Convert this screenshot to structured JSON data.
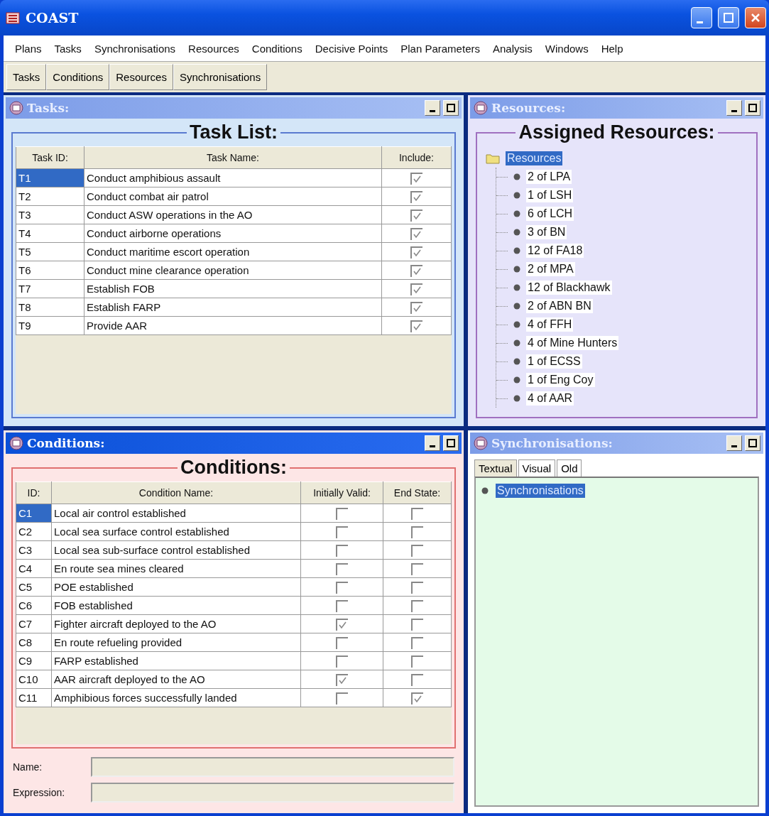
{
  "window": {
    "title": "COAST"
  },
  "menu": [
    "Plans",
    "Tasks",
    "Synchronisations",
    "Resources",
    "Conditions",
    "Decisive Points",
    "Plan Parameters",
    "Analysis",
    "Windows",
    "Help"
  ],
  "toolbar": [
    "Tasks",
    "Conditions",
    "Resources",
    "Synchronisations"
  ],
  "tasks": {
    "title": "Tasks:",
    "active": false,
    "legend": "Task List:",
    "columns": [
      "Task ID:",
      "Task Name:",
      "Include:"
    ],
    "rows": [
      {
        "id": "T1",
        "name": "Conduct amphibious assault",
        "include": true,
        "selected": true
      },
      {
        "id": "T2",
        "name": "Conduct combat air patrol",
        "include": true,
        "selected": false
      },
      {
        "id": "T3",
        "name": "Conduct ASW operations in the AO",
        "include": true,
        "selected": false
      },
      {
        "id": "T4",
        "name": "Conduct airborne operations",
        "include": true,
        "selected": false
      },
      {
        "id": "T5",
        "name": "Conduct maritime escort operation",
        "include": true,
        "selected": false
      },
      {
        "id": "T6",
        "name": "Conduct mine clearance operation",
        "include": true,
        "selected": false
      },
      {
        "id": "T7",
        "name": "Establish FOB",
        "include": true,
        "selected": false
      },
      {
        "id": "T8",
        "name": "Establish FARP",
        "include": true,
        "selected": false
      },
      {
        "id": "T9",
        "name": "Provide AAR",
        "include": true,
        "selected": false
      }
    ]
  },
  "resources": {
    "title": "Resources:",
    "active": false,
    "legend": "Assigned Resources:",
    "tree": {
      "label": "Resources",
      "selected": true,
      "children": [
        {
          "label": "2 of LPA",
          "selected": false
        },
        {
          "label": "1 of LSH",
          "selected": false
        },
        {
          "label": "6 of LCH",
          "selected": false
        },
        {
          "label": "3 of BN",
          "selected": false
        },
        {
          "label": "12 of FA18",
          "selected": false
        },
        {
          "label": "2 of MPA",
          "selected": false
        },
        {
          "label": "12 of Blackhawk",
          "selected": false
        },
        {
          "label": "2 of ABN BN",
          "selected": false
        },
        {
          "label": "4 of FFH",
          "selected": false
        },
        {
          "label": "4 of Mine Hunters",
          "selected": false
        },
        {
          "label": "1 of ECSS",
          "selected": false
        },
        {
          "label": "1 of Eng Coy",
          "selected": false
        },
        {
          "label": "4 of AAR",
          "selected": false
        }
      ]
    }
  },
  "conditions": {
    "title": "Conditions:",
    "active": true,
    "legend": "Conditions:",
    "columns": [
      "ID:",
      "Condition Name:",
      "Initially Valid:",
      "End State:"
    ],
    "rows": [
      {
        "id": "C1",
        "name": "Local air control established",
        "initially_valid": false,
        "end_state": false,
        "selected": true
      },
      {
        "id": "C2",
        "name": "Local sea surface control established",
        "initially_valid": false,
        "end_state": false,
        "selected": false
      },
      {
        "id": "C3",
        "name": "Local sea sub-surface control established",
        "initially_valid": false,
        "end_state": false,
        "selected": false
      },
      {
        "id": "C4",
        "name": "En route sea mines cleared",
        "initially_valid": false,
        "end_state": false,
        "selected": false
      },
      {
        "id": "C5",
        "name": "POE established",
        "initially_valid": false,
        "end_state": false,
        "selected": false
      },
      {
        "id": "C6",
        "name": "FOB established",
        "initially_valid": false,
        "end_state": false,
        "selected": false
      },
      {
        "id": "C7",
        "name": "Fighter aircraft deployed to the AO",
        "initially_valid": true,
        "end_state": false,
        "selected": false
      },
      {
        "id": "C8",
        "name": "En route refueling provided",
        "initially_valid": false,
        "end_state": false,
        "selected": false
      },
      {
        "id": "C9",
        "name": "FARP established",
        "initially_valid": false,
        "end_state": false,
        "selected": false
      },
      {
        "id": "C10",
        "name": "AAR aircraft deployed to the AO",
        "initially_valid": true,
        "end_state": false,
        "selected": false
      },
      {
        "id": "C11",
        "name": "Amphibious forces successfully landed",
        "initially_valid": false,
        "end_state": true,
        "selected": false
      }
    ],
    "fields": [
      {
        "label": "Name:"
      },
      {
        "label": "Expression:"
      }
    ]
  },
  "synchronisations": {
    "title": "Synchronisations:",
    "active": false,
    "tabs": [
      {
        "label": "Textual",
        "selected": true
      },
      {
        "label": "Visual",
        "selected": false
      },
      {
        "label": "Old",
        "selected": false
      }
    ],
    "tree": [
      {
        "label": "Synchronisations",
        "selected": true
      }
    ]
  }
}
